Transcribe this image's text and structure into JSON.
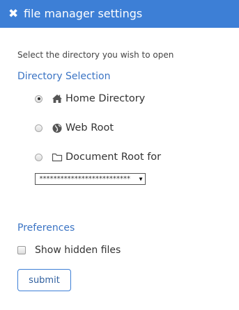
{
  "dialog": {
    "close_icon": "close-icon",
    "title": "file manager settings"
  },
  "prompt": "Select the directory you wish to open",
  "directory_selection": {
    "heading": "Directory Selection",
    "options": [
      {
        "label": "Home Directory",
        "icon": "home-icon",
        "checked": true
      },
      {
        "label": "Web Root",
        "icon": "globe-icon",
        "checked": false
      },
      {
        "label": "Document Root for",
        "icon": "folder-icon",
        "checked": false
      }
    ],
    "docroot_select": {
      "selected": "**************************"
    }
  },
  "preferences": {
    "heading": "Preferences",
    "show_hidden_label": "Show hidden files",
    "show_hidden_checked": false
  },
  "submit_label": "submit",
  "colors": {
    "titlebar": "#3d7fd6",
    "heading": "#3b74c4"
  }
}
